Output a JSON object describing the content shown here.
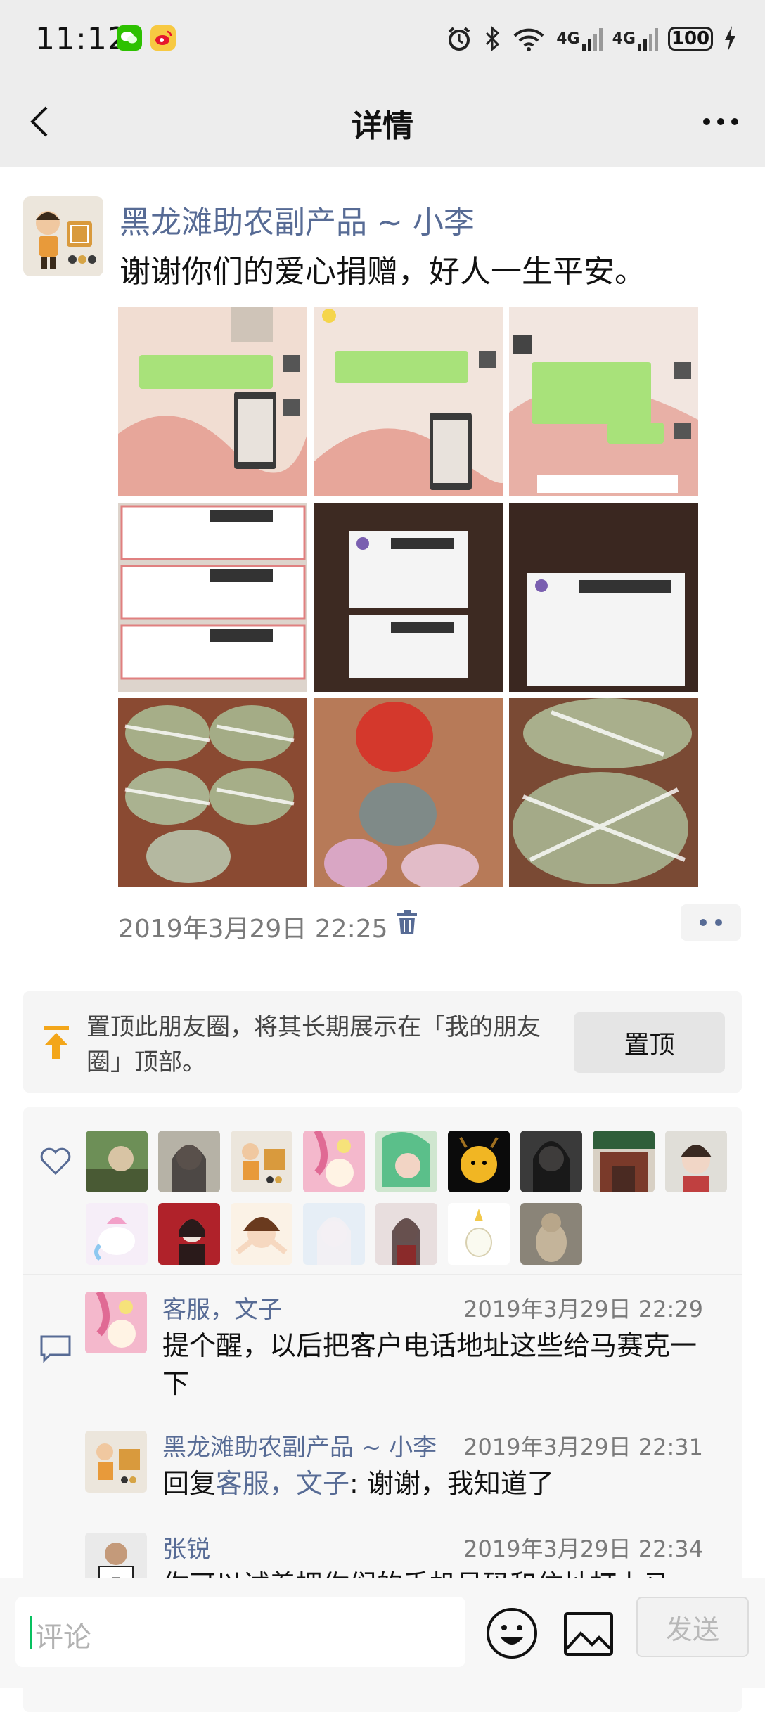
{
  "status_bar": {
    "time": "11:12",
    "network_1": "4G",
    "network_2": "4G",
    "battery": "100",
    "icons": [
      "wechat-icon",
      "weibo-icon",
      "alarm-icon",
      "bluetooth-icon",
      "wifi-icon",
      "signal-icon",
      "charging-icon"
    ]
  },
  "nav": {
    "title": "详情",
    "icons": [
      "back-icon",
      "more-icon"
    ]
  },
  "post": {
    "author": "黑龙滩助农副产品 ~ 小李",
    "text": "谢谢你们的爱心捐赠，好人一生平安。",
    "time": "2019年3月29日 22:25",
    "photos": [
      "chat-screenshot-1",
      "chat-screenshot-2",
      "chat-screenshot-3",
      "shipping-labels",
      "shipping-label-package",
      "shipping-label-closeup",
      "wrapped-packages",
      "bags-on-floor",
      "wrapped-package-large"
    ]
  },
  "pin": {
    "text": "置顶此朋友圈，将其长期展示在「我的朋友圈」顶部。",
    "button": "置顶"
  },
  "likes": {
    "count_visible": 16
  },
  "comments": [
    {
      "name": "客服，文子",
      "time": "2019年3月29日 22:29",
      "text": "提个醒，以后把客户电话地址这些给马赛克一下"
    },
    {
      "name": "黑龙滩助农副产品 ~ 小李",
      "time": "2019年3月29日 22:31",
      "reply_prefix": "回复",
      "reply_to": "客服，文子",
      "reply_text": ": 谢谢，我知道了"
    },
    {
      "name": "张锐",
      "time": "2019年3月29日 22:34",
      "text": "你可以试着把你们的手机号码和住址打上马"
    }
  ],
  "input": {
    "placeholder": "评论",
    "send": "发送"
  },
  "colors": {
    "link": "#576b95",
    "accent": "#07c160",
    "bar_bg": "#ededed"
  }
}
